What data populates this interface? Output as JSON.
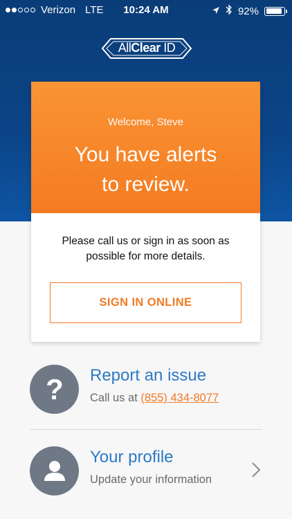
{
  "status_bar": {
    "carrier": "Verizon",
    "network": "LTE",
    "time": "10:24 AM",
    "battery": "92%",
    "battery_level": 0.92,
    "signal_bars_filled": 2,
    "signal_bars_total": 5
  },
  "logo": {
    "part1": "All",
    "part2": "Clear",
    "part3": " ID"
  },
  "alert": {
    "welcome": "Welcome, Steve",
    "headline_line1": "You have alerts",
    "headline_line2": "to review.",
    "body": "Please call us or sign in as soon as possible for more details.",
    "button_label": "SIGN IN ONLINE"
  },
  "report": {
    "title": "Report an issue",
    "sub_prefix": "Call us at ",
    "phone": "(855) 434-8077"
  },
  "profile": {
    "title": "Your profile",
    "sub": "Update your information"
  },
  "colors": {
    "header_blue": "#0b4487",
    "alert_orange": "#f57b22",
    "link_blue": "#2d7ac4",
    "icon_gray": "#6f7885"
  }
}
